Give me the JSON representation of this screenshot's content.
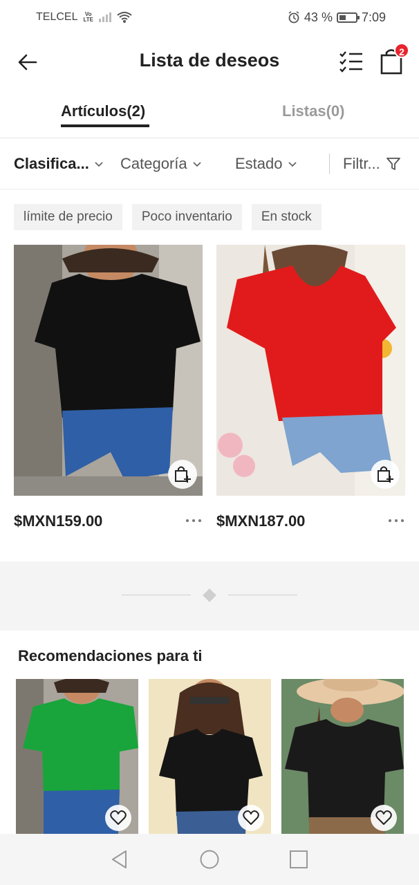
{
  "status_bar": {
    "carrier": "TELCEL",
    "volte_top": "Vo",
    "volte_bottom": "LTE",
    "battery": "43 %",
    "time": "7:09"
  },
  "header": {
    "title": "Lista de deseos",
    "cart_count": "2"
  },
  "tabs": [
    {
      "label": "Artículos(2)",
      "active": true
    },
    {
      "label": "Listas(0)",
      "active": false
    }
  ],
  "filters": {
    "sort": "Clasifica...",
    "category": "Categoría",
    "state": "Estado",
    "filter": "Filtr..."
  },
  "chips": [
    "límite de precio",
    "Poco inventario",
    "En stock"
  ],
  "products": [
    {
      "price": "$MXN159.00",
      "shirt_color": "#111111"
    },
    {
      "price": "$MXN187.00",
      "shirt_color": "#e11b1b"
    }
  ],
  "recommendations": {
    "title": "Recomendaciones para ti",
    "items": [
      {
        "shirt_color": "#19a53b"
      },
      {
        "shirt_color": "#151515"
      },
      {
        "shirt_color": "#1a1a1a"
      }
    ]
  },
  "colors": {
    "accent_badge": "#e7242d",
    "text_primary": "#222222",
    "chip_bg": "#f2f2f2"
  }
}
